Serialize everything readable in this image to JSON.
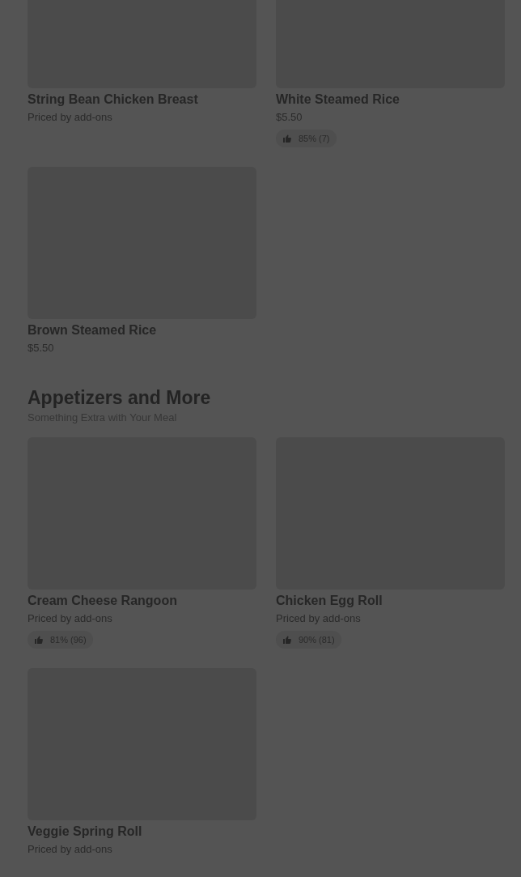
{
  "sections": [
    {
      "items": [
        {
          "name": "String Bean Chicken Breast",
          "price": "Priced by add-ons"
        },
        {
          "name": "White Steamed Rice",
          "price": "$5.50",
          "rating": "85% (7)"
        },
        {
          "name": "Brown Steamed Rice",
          "price": "$5.50"
        }
      ]
    },
    {
      "title": "Appetizers and More",
      "subtitle": "Something Extra with Your Meal",
      "items": [
        {
          "name": "Cream Cheese Rangoon",
          "price": "Priced by add-ons",
          "rating": "81% (96)"
        },
        {
          "name": "Chicken Egg Roll",
          "price": "Priced by add-ons",
          "rating": "90% (81)"
        },
        {
          "name": "Veggie Spring Roll",
          "price": "Priced by add-ons"
        }
      ]
    }
  ]
}
